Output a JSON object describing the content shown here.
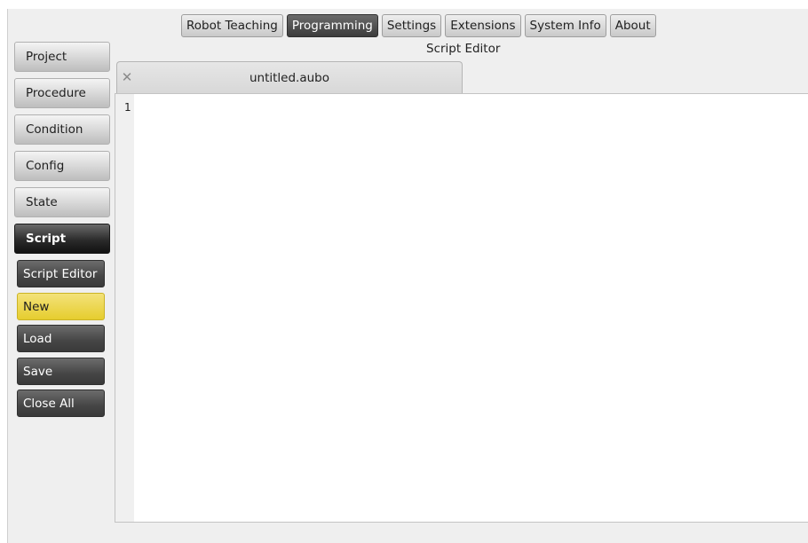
{
  "top_tabs": [
    {
      "label": "Robot Teaching"
    },
    {
      "label": "Programming"
    },
    {
      "label": "Settings"
    },
    {
      "label": "Extensions"
    },
    {
      "label": "System Info"
    },
    {
      "label": "About"
    }
  ],
  "active_top_tab": "Programming",
  "sidebar": {
    "items": [
      {
        "label": "Project"
      },
      {
        "label": "Procedure"
      },
      {
        "label": "Condition"
      },
      {
        "label": "Config"
      },
      {
        "label": "State"
      },
      {
        "label": "Script"
      }
    ],
    "active_item": "Script",
    "sub_items": [
      {
        "label": "Script Editor"
      },
      {
        "label": "New"
      },
      {
        "label": "Load"
      },
      {
        "label": "Save"
      },
      {
        "label": "Close All"
      }
    ],
    "highlighted_sub_item": "New"
  },
  "editor": {
    "title": "Script Editor",
    "file_tab": {
      "name": "untitled.aubo",
      "close_icon": "close-icon"
    },
    "line_numbers": [
      "1"
    ]
  },
  "colors": {
    "active_tab": "#3c3c3c",
    "highlight_yellow": "#e6cd2e",
    "background": "#efefef"
  }
}
